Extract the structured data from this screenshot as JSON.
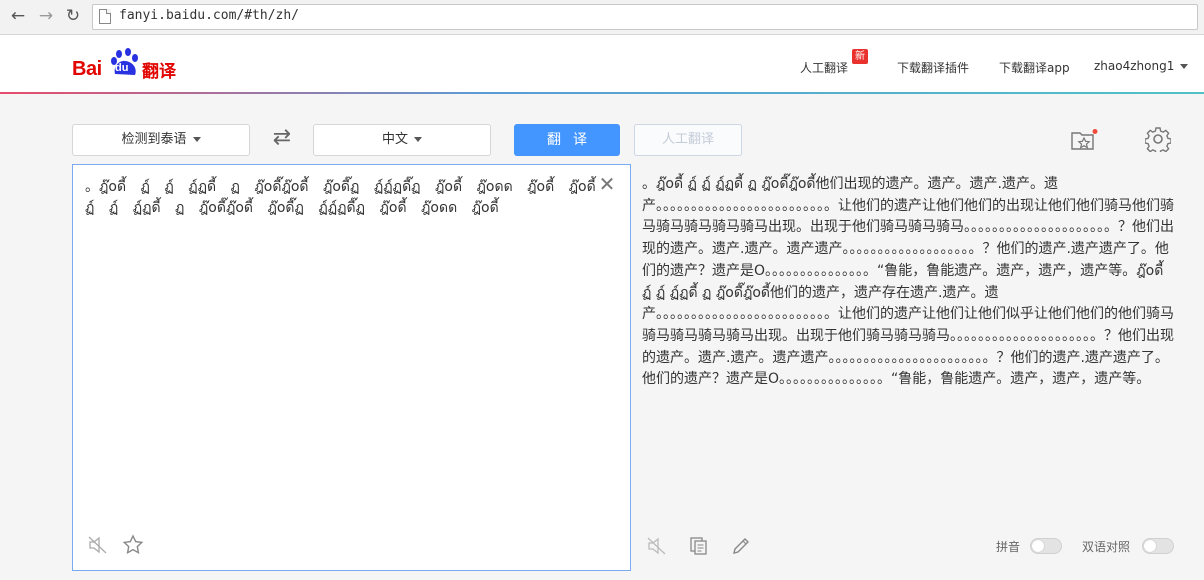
{
  "browser": {
    "url": "fanyi.baidu.com/#th/zh/"
  },
  "header": {
    "logo_text": "Bai",
    "logo_du": "du",
    "logo_fanyi": "翻译",
    "nav": {
      "human_translate": "人工翻译",
      "new_badge": "新",
      "download_plugin": "下载翻译插件",
      "download_app": "下载翻译app",
      "username": "zhao4zhong1"
    }
  },
  "toolbar": {
    "source_lang": "检测到泰语",
    "swap_icon": "⇄",
    "target_lang": "中文",
    "translate_button": "翻译",
    "human_button": "人工翻译"
  },
  "input": {
    "text": "。ฎ๊oดี้ ฏ์ ฏ์ ฏ์ฏดี้ ฏ ฎ๊oดี๊ฎ๊oดี้ ฎ๊oดี๊ฏ ฏ์ฏ์ฏดี๊ฏ ฎ๊oดี้ ฎ๊oดด ฎ๊oดี้ ฎ๊oดี้ ฏ์ ฏ์ ฏ์ฏดี้ ฏ ฎ๊oดี๊ฎ๊oดี้ ฎ๊oดี๊ฏ ฏ์ฏ์ฏดี๊ฏ ฎ๊oดี้ ฎ๊oดด ฎ๊oดี้"
  },
  "output": {
    "text": "。ฎ๊oดี้ ฏ์ ฏ์ ฏ์ฏดี้ ฏ ฎ๊oดี๊ฎ๊oดี้他们出现的遗产。遗产。遗产.遗产。遗产。。。。。。。。。。。。。。。。。。。。。。。。。让他们的遗产让他们他们的出现让他们他们骑马他们骑马骑马骑马骑马骑马出现。出现于他们骑马骑马骑马。。。。。。。。。。。。。。。。。。。。。？他们出现的遗产。遗产.遗产。遗产遗产。。。。。。。。。。。。。。。。。。。？他们的遗产.遗产遗产了。他们的遗产？遗产是O。。。。。。。。。。。。。。。“鲁能，鲁能遗产。遗产，遗产，遗产等。ฎ๊oดี้ ฏ์ ฏ์ ฏ์ฏดี้ ฏ ฎ๊oดี๊ฎ๊oดี้他们的遗产，遗产存在遗产.遗产。遗产。。。。。。。。。。。。。。。。。。。。。。。。。让他们的遗产让他们让他们似乎让他们他们的他们骑马骑马骑马骑马骑马出现。出现于他们骑马骑马骑马。。。。。。。。。。。。。。。。。。。。。？他们出现的遗产。遗产.遗产。遗产遗产。。。。。。。。。。。。。。。。。。。。。。。？他们的遗产.遗产遗产了。他们的遗产？遗产是O。。。。。。。。。。。。。。。“鲁能，鲁能遗产。遗产，遗产，遗产等。",
    "pinyin_label": "拼音",
    "bilingual_label": "双语对照"
  },
  "icons": {
    "back": "back-arrow-icon",
    "forward": "forward-arrow-icon",
    "reload": "reload-icon",
    "page": "page-icon",
    "favorites": "favorites-folder-icon",
    "settings": "gear-icon",
    "clear": "close-icon",
    "speaker": "speaker-muted-icon",
    "star": "star-icon",
    "copy": "copy-icon",
    "edit": "pencil-icon"
  },
  "colors": {
    "brand_red": "#e10601",
    "primary_blue": "#4395ff",
    "input_border": "#7aaaf4"
  }
}
